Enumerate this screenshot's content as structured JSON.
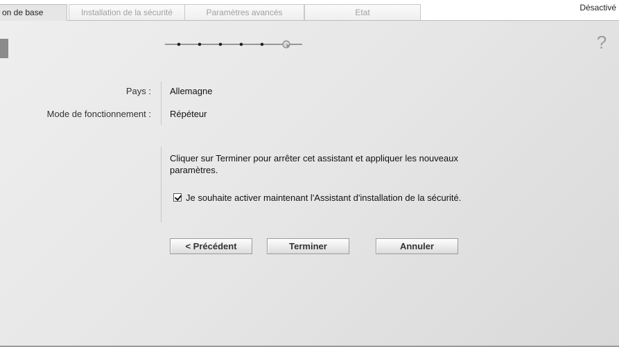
{
  "tabs": [
    {
      "label": "on de base",
      "active": true
    },
    {
      "label": "Installation de la sécurité",
      "active": false
    },
    {
      "label": "Paramètres avancés",
      "active": false
    },
    {
      "label": "Etat",
      "active": false
    }
  ],
  "status": {
    "text": "Désactivé"
  },
  "wizard": {
    "progress": {
      "total_steps": 7,
      "current_step": 7
    },
    "help_icon": "?",
    "fields": [
      {
        "label": "Pays :",
        "value": "Allemagne"
      },
      {
        "label": "Mode de fonctionnement :",
        "value": "Répéteur"
      }
    ],
    "description": "Cliquer sur Terminer pour arrêter cet assistant et appliquer les nouveaux paramètres.",
    "checkbox": {
      "checked": true,
      "label": "Je souhaite activer maintenant l'Assistant d'installation de la sécurité."
    },
    "buttons": {
      "previous": "< Précédent",
      "finish": "Terminer",
      "cancel": "Annuler"
    }
  },
  "icons": {
    "help": "help-icon",
    "checkbox": "checkbox-icon"
  }
}
